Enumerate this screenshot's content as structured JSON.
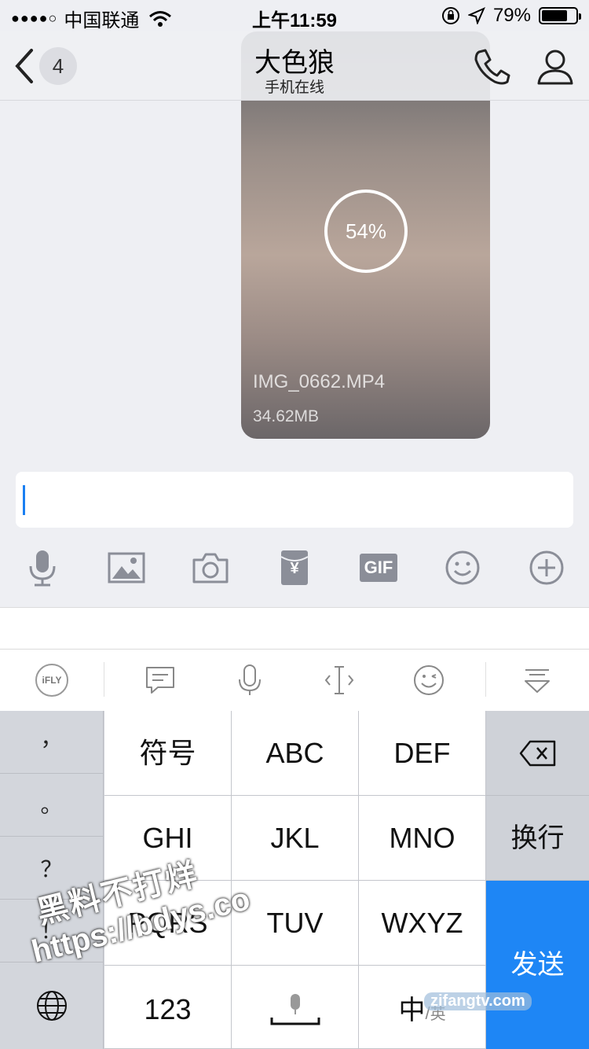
{
  "status_bar": {
    "signal_dots": "●●●●○",
    "carrier": "中国联通",
    "time": "上午11:59",
    "battery_text": "79%",
    "battery_level": 0.79
  },
  "nav": {
    "back_count": "4",
    "title": "大色狼",
    "subtitle": "手机在线",
    "icons": [
      "chevron-left-icon",
      "phone-icon",
      "person-icon"
    ]
  },
  "video": {
    "progress_text": "54%",
    "filename": "IMG_0662.MP4",
    "filesize": "34.62MB"
  },
  "input": {
    "value": ""
  },
  "toolbar": {
    "icons": [
      "microphone-icon",
      "image-icon",
      "camera-icon",
      "red-envelope-icon",
      "gif-icon",
      "emoji-icon",
      "plus-icon"
    ],
    "gif_label": "GIF",
    "envelope_label": "¥"
  },
  "ime_bar": {
    "brand": "iFLY",
    "icons": [
      "ifly-logo-icon",
      "message-icon",
      "voice-icon",
      "cursor-icon",
      "emoji-icon",
      "hide-keyboard-icon"
    ]
  },
  "keyboard": {
    "left_keys": [
      "，",
      "。",
      "？",
      "！"
    ],
    "rows": [
      [
        "符号",
        "ABC",
        "DEF"
      ],
      [
        "GHI",
        "JKL",
        "MNO"
      ],
      [
        "PQRS",
        "TUV",
        "WXYZ"
      ]
    ],
    "bottom": {
      "numbers": "123",
      "lang_main": "中",
      "lang_sep": "/",
      "lang_sub": "英"
    },
    "newline": "换行",
    "send": "发送",
    "icons": [
      "globe-icon",
      "backspace-icon",
      "space-mic-icon"
    ]
  },
  "watermarks": {
    "line1": "黑料不打烊",
    "line2": "https://bdys.co",
    "corner": "zifangtv.com"
  },
  "colors": {
    "accent": "#1e86f5",
    "caret": "#1a7ff2"
  }
}
